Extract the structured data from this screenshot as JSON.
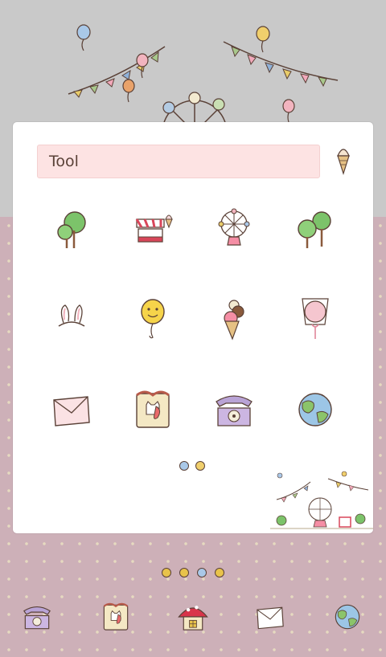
{
  "folder": {
    "title": "Tool",
    "apps": [
      {
        "icon": "tree-icon"
      },
      {
        "icon": "ice-cream-stand-icon"
      },
      {
        "icon": "ferris-wheel-icon"
      },
      {
        "icon": "trees-icon"
      },
      {
        "icon": "bunny-ears-icon"
      },
      {
        "icon": "smiley-balloon-icon"
      },
      {
        "icon": "ice-cream-cone-icon"
      },
      {
        "icon": "cotton-candy-icon"
      },
      {
        "icon": "envelope-icon"
      },
      {
        "icon": "shop-bag-icon"
      },
      {
        "icon": "telephone-icon"
      },
      {
        "icon": "globe-icon"
      }
    ],
    "pages": 2,
    "active_page": 2
  },
  "home_pages": 4,
  "dock": [
    {
      "icon": "telephone-icon"
    },
    {
      "icon": "shop-bag-icon"
    },
    {
      "icon": "mushroom-house-icon"
    },
    {
      "icon": "envelope-icon"
    },
    {
      "icon": "globe-icon"
    }
  ],
  "colors": {
    "top_background": "#c9c9c9",
    "bottom_background": "#cdb0b8",
    "title_bar": "#fde3e3",
    "outline": "#5a4137"
  }
}
